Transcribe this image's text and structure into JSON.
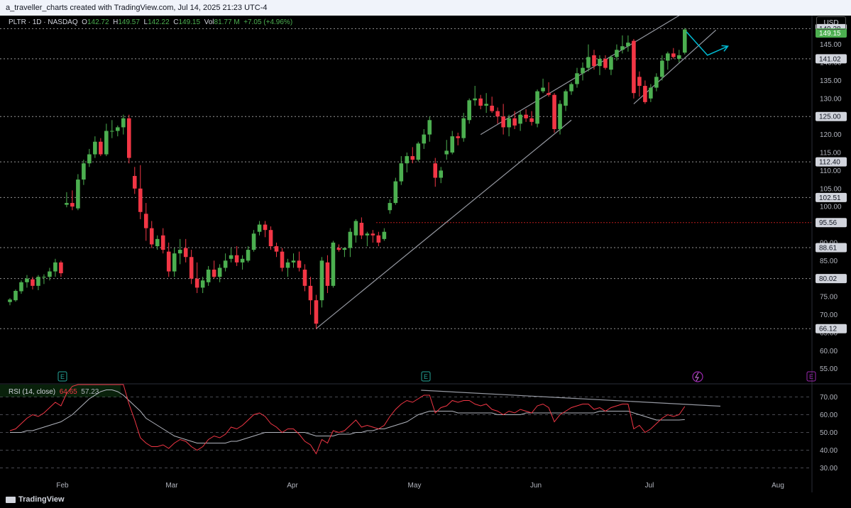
{
  "header": {
    "text": "a_traveller_charts created with TradingView.com, Jul 14, 2025 21:23 UTC-4"
  },
  "legend": {
    "symbol": "PLTR · 1D · NASDAQ",
    "o_label": "O",
    "o": "142.72",
    "h_label": "H",
    "h": "149.57",
    "l_label": "L",
    "l": "142.22",
    "c_label": "C",
    "c": "149.15",
    "vol_label": "Vol",
    "vol": "81.77 M",
    "change": "+7.05 (+4.96%)"
  },
  "currency": "USD",
  "rsi_legend": {
    "label": "RSI (14, close)",
    "rsi": "64.65",
    "ma": "57.23"
  },
  "footer": {
    "brand": "TradingView"
  },
  "colors": {
    "up": "#4caf50",
    "down": "#f23645",
    "rsi": "#f23645",
    "rsi_ma": "#b2b5be",
    "trendline": "#9598a1",
    "arrow": "#00bcd4",
    "support": "#b71c1c"
  },
  "chart_data": {
    "type": "candlestick",
    "ticker": "PLTR",
    "interval": "1D",
    "exchange": "NASDAQ",
    "x_labels": [
      "Feb",
      "Mar",
      "Apr",
      "May",
      "Jun",
      "Jul",
      "Aug"
    ],
    "price_axis": {
      "ylim": [
        51,
        153
      ],
      "ticks": [
        55,
        60,
        65,
        70,
        75,
        80,
        85,
        90,
        95,
        100,
        105,
        110,
        115,
        120,
        125,
        130,
        135,
        140,
        145
      ],
      "tick_labels": [
        "55.00",
        "60.00",
        "65.00",
        "70.00",
        "75.00",
        "80.00",
        "85.00",
        "90.00",
        "95.00",
        "100.00",
        "105.00",
        "110.00",
        "115.00",
        "120.00",
        "125.00",
        "130.00",
        "135.00",
        "140.00",
        "145.00"
      ]
    },
    "price_levels": [
      {
        "value": 149.38,
        "label": "149.38",
        "style": "dotted",
        "tag": "grey"
      },
      {
        "value": 149.15,
        "label": "149.15",
        "style": "none",
        "tag": "green"
      },
      {
        "value": 141.02,
        "label": "141.02",
        "style": "dotted",
        "tag": "grey"
      },
      {
        "value": 125.0,
        "label": "125.00",
        "style": "dotted",
        "tag": "grey"
      },
      {
        "value": 112.4,
        "label": "112.40",
        "style": "dotted",
        "tag": "grey"
      },
      {
        "value": 102.51,
        "label": "102.51",
        "style": "dotted",
        "tag": "grey"
      },
      {
        "value": 95.56,
        "label": "95.56",
        "style": "red-dotted",
        "tag": "grey"
      },
      {
        "value": 88.61,
        "label": "88.61",
        "style": "dotted",
        "tag": "grey"
      },
      {
        "value": 80.02,
        "label": "80.02",
        "style": "dotted",
        "tag": "grey"
      },
      {
        "value": 66.12,
        "label": "66.12",
        "style": "dotted",
        "tag": "grey"
      }
    ],
    "candles": [
      [
        73.5,
        74.6,
        72.6,
        74.2
      ],
      [
        74.0,
        77.0,
        73.6,
        76.6
      ],
      [
        76.5,
        79.5,
        75.8,
        79.0
      ],
      [
        79.0,
        81.0,
        77.5,
        80.0
      ],
      [
        79.8,
        80.5,
        77.0,
        78.0
      ],
      [
        78.0,
        81.0,
        76.8,
        80.5
      ],
      [
        80.5,
        81.2,
        78.5,
        80.5
      ],
      [
        80.5,
        83.0,
        79.5,
        82.0
      ],
      [
        82.0,
        85.5,
        80.5,
        84.5
      ],
      [
        84.5,
        85.0,
        80.5,
        81.5
      ],
      [
        100.5,
        104.0,
        99.8,
        101.0
      ],
      [
        101.0,
        104.5,
        99.0,
        100.0
      ],
      [
        99.5,
        109.0,
        99.0,
        107.5
      ],
      [
        107.5,
        113.0,
        106.0,
        112.0
      ],
      [
        112.0,
        116.0,
        111.0,
        114.5
      ],
      [
        114.5,
        119.5,
        113.5,
        118.0
      ],
      [
        118.0,
        119.0,
        114.0,
        114.5
      ],
      [
        114.5,
        123.0,
        114.0,
        121.0
      ],
      [
        121.0,
        124.0,
        119.0,
        121.0
      ],
      [
        121.0,
        122.5,
        119.5,
        122.0
      ],
      [
        122.0,
        125.5,
        120.0,
        124.5
      ],
      [
        124.5,
        125.5,
        112.0,
        113.5
      ],
      [
        108.5,
        111.0,
        103.5,
        105.0
      ],
      [
        105.0,
        111.5,
        96.5,
        98.5
      ],
      [
        98.0,
        101.0,
        90.5,
        94.0
      ],
      [
        94.0,
        96.0,
        88.5,
        89.5
      ],
      [
        89.0,
        92.0,
        88.0,
        91.0
      ],
      [
        92.0,
        94.0,
        87.0,
        88.0
      ],
      [
        87.5,
        90.0,
        80.5,
        82.0
      ],
      [
        82.0,
        88.5,
        80.5,
        87.0
      ],
      [
        87.0,
        91.0,
        84.0,
        88.0
      ],
      [
        88.5,
        91.0,
        84.5,
        86.0
      ],
      [
        86.0,
        88.0,
        78.5,
        80.0
      ],
      [
        80.0,
        84.5,
        76.0,
        77.5
      ],
      [
        77.5,
        80.5,
        76.0,
        79.5
      ],
      [
        79.0,
        83.5,
        78.0,
        82.5
      ],
      [
        82.5,
        85.0,
        80.0,
        80.5
      ],
      [
        80.5,
        84.0,
        79.0,
        83.0
      ],
      [
        83.0,
        87.0,
        82.0,
        85.0
      ],
      [
        85.5,
        88.5,
        84.5,
        86.5
      ],
      [
        86.5,
        89.0,
        83.5,
        84.5
      ],
      [
        84.5,
        86.5,
        82.5,
        85.5
      ],
      [
        85.0,
        89.0,
        84.5,
        88.0
      ],
      [
        88.0,
        93.5,
        87.5,
        92.5
      ],
      [
        93.0,
        96.0,
        92.0,
        95.0
      ],
      [
        95.0,
        96.0,
        91.5,
        93.5
      ],
      [
        93.5,
        94.5,
        88.0,
        89.0
      ],
      [
        89.0,
        90.0,
        86.0,
        87.5
      ],
      [
        87.5,
        88.5,
        82.0,
        83.0
      ],
      [
        83.0,
        85.5,
        80.5,
        84.5
      ],
      [
        84.5,
        87.0,
        83.0,
        85.0
      ],
      [
        85.0,
        87.5,
        82.0,
        83.0
      ],
      [
        82.5,
        84.0,
        76.5,
        78.0
      ],
      [
        78.0,
        80.5,
        70.0,
        74.0
      ],
      [
        74.0,
        75.5,
        66.1,
        67.5
      ],
      [
        74.0,
        86.0,
        72.0,
        85.0
      ],
      [
        84.5,
        86.5,
        76.0,
        78.0
      ],
      [
        78.0,
        90.5,
        77.5,
        90.0
      ],
      [
        88.5,
        89.5,
        87.5,
        88.0
      ],
      [
        88.0,
        88.5,
        86.0,
        88.5
      ],
      [
        88.5,
        94.0,
        86.0,
        93.0
      ],
      [
        92.0,
        96.5,
        90.0,
        96.0
      ],
      [
        95.5,
        97.0,
        91.0,
        92.0
      ],
      [
        92.0,
        93.0,
        89.0,
        92.5
      ],
      [
        92.5,
        93.5,
        90.0,
        92.0
      ],
      [
        92.0,
        93.0,
        89.0,
        90.0
      ],
      [
        91.0,
        94.0,
        90.5,
        93.0
      ],
      [
        99.0,
        102.0,
        98.0,
        101.0
      ],
      [
        101.0,
        108.0,
        100.5,
        107.0
      ],
      [
        107.0,
        114.0,
        106.0,
        112.0
      ],
      [
        112.0,
        115.0,
        109.5,
        114.0
      ],
      [
        114.0,
        116.5,
        112.0,
        113.0
      ],
      [
        113.0,
        118.0,
        112.5,
        117.5
      ],
      [
        117.5,
        121.5,
        116.0,
        120.0
      ],
      [
        120.0,
        125.0,
        118.0,
        124.0
      ],
      [
        112.0,
        113.5,
        105.5,
        108.0
      ],
      [
        108.0,
        111.0,
        106.5,
        110.0
      ],
      [
        114.5,
        118.5,
        113.0,
        115.5
      ],
      [
        115.0,
        121.0,
        114.5,
        119.5
      ],
      [
        119.5,
        120.5,
        117.0,
        119.0
      ],
      [
        119.0,
        126.0,
        118.0,
        124.5
      ],
      [
        124.0,
        130.0,
        123.0,
        129.5
      ],
      [
        129.5,
        133.5,
        128.0,
        130.0
      ],
      [
        130.0,
        131.0,
        127.0,
        128.0
      ],
      [
        128.0,
        131.5,
        126.0,
        128.5
      ],
      [
        128.0,
        130.5,
        126.0,
        126.5
      ],
      [
        126.5,
        127.5,
        123.0,
        125.0
      ],
      [
        125.0,
        128.5,
        120.0,
        122.0
      ],
      [
        122.0,
        125.5,
        119.5,
        124.5
      ],
      [
        124.5,
        126.5,
        121.5,
        122.5
      ],
      [
        123.0,
        126.5,
        121.0,
        125.5
      ],
      [
        125.5,
        127.0,
        123.5,
        124.5
      ],
      [
        124.5,
        126.5,
        122.5,
        123.5
      ],
      [
        123.0,
        132.5,
        122.0,
        132.0
      ],
      [
        132.0,
        135.5,
        131.5,
        133.0
      ],
      [
        131.5,
        134.5,
        130.5,
        131.0
      ],
      [
        131.0,
        131.5,
        120.5,
        121.5
      ],
      [
        121.5,
        129.5,
        120.0,
        128.5
      ],
      [
        128.0,
        132.5,
        126.5,
        132.0
      ],
      [
        132.0,
        134.5,
        131.0,
        134.0
      ],
      [
        134.0,
        138.5,
        133.0,
        137.0
      ],
      [
        137.0,
        140.0,
        135.0,
        138.5
      ],
      [
        138.5,
        145.0,
        137.5,
        141.5
      ],
      [
        142.0,
        143.5,
        138.0,
        139.0
      ],
      [
        139.0,
        142.0,
        136.5,
        141.0
      ],
      [
        141.0,
        142.0,
        138.0,
        138.5
      ],
      [
        138.0,
        142.0,
        136.5,
        141.5
      ],
      [
        141.5,
        145.0,
        140.5,
        143.5
      ],
      [
        143.5,
        147.5,
        142.5,
        144.5
      ],
      [
        144.5,
        147.5,
        143.0,
        145.5
      ],
      [
        146.0,
        146.5,
        130.0,
        131.5
      ],
      [
        136.0,
        137.5,
        130.5,
        133.5
      ],
      [
        133.5,
        135.0,
        128.5,
        129.0
      ],
      [
        130.0,
        134.0,
        129.0,
        133.0
      ],
      [
        133.0,
        137.0,
        132.0,
        136.0
      ],
      [
        136.0,
        142.0,
        135.0,
        140.5
      ],
      [
        140.5,
        143.0,
        138.0,
        142.5
      ],
      [
        142.5,
        144.0,
        141.0,
        141.5
      ],
      [
        141.0,
        143.5,
        140.0,
        142.0
      ],
      [
        142.72,
        149.57,
        142.22,
        149.15
      ]
    ],
    "rsi": {
      "label": "RSI (14, close)",
      "ylim": [
        25,
        77
      ],
      "ticks": [
        30,
        40,
        50,
        60,
        70
      ],
      "tick_labels": [
        "30.00",
        "40.00",
        "50.00",
        "60.00",
        "70.00"
      ],
      "rsi_last": 64.65,
      "ma_last": 57.23,
      "rsi_values": [
        51,
        52,
        55,
        58,
        60,
        59,
        61,
        64,
        67,
        65,
        72,
        76,
        78,
        80,
        82,
        82,
        79,
        81,
        82,
        79,
        80,
        66,
        57,
        47,
        44,
        42,
        42,
        43,
        41,
        44,
        46,
        45,
        42,
        40,
        42,
        46,
        48,
        47,
        49,
        53,
        52,
        54,
        57,
        60,
        61,
        59,
        55,
        53,
        50,
        52,
        52,
        49,
        45,
        43,
        38,
        46,
        44,
        51,
        50,
        51,
        54,
        57,
        53,
        54,
        53,
        52,
        54,
        59,
        63,
        66,
        68,
        67,
        69,
        71,
        71,
        61,
        64,
        65,
        68,
        67,
        68,
        68,
        66,
        65,
        66,
        63,
        62,
        60,
        62,
        61,
        63,
        62,
        61,
        65,
        66,
        64,
        56,
        60,
        62,
        64,
        65,
        66,
        66,
        63,
        64,
        62,
        64,
        65,
        66,
        66,
        52,
        54,
        50,
        52,
        55,
        58,
        60,
        59,
        60,
        64.65
      ],
      "ma_values": [
        50,
        50,
        50,
        51,
        51,
        52,
        53,
        54,
        55,
        56,
        58,
        60,
        63,
        66,
        69,
        71,
        73,
        74,
        74,
        73,
        71,
        68,
        65,
        62,
        58,
        56,
        54,
        52,
        50,
        48,
        47,
        46,
        45,
        44,
        44,
        44,
        44,
        44,
        44,
        45,
        45,
        46,
        47,
        48,
        49,
        50,
        50,
        50,
        50,
        50,
        50,
        50,
        50,
        49,
        48,
        48,
        48,
        48,
        49,
        49,
        49,
        50,
        50,
        51,
        51,
        52,
        52,
        53,
        54,
        55,
        56,
        58,
        60,
        61,
        62,
        62,
        62,
        62,
        62,
        61,
        61,
        61,
        61,
        61,
        61,
        61,
        60,
        60,
        60,
        60,
        60,
        61,
        61,
        61,
        61,
        61,
        61,
        61,
        61,
        61,
        61,
        61,
        61,
        61,
        62,
        62,
        62,
        62,
        62,
        62,
        61,
        60,
        59,
        58,
        57,
        57,
        57,
        57,
        57,
        57.23
      ]
    },
    "rsi_trendline": {
      "from": [
        0.835,
        73.8
      ],
      "to": [
        1.25,
        64.8
      ]
    },
    "trendlines": [
      {
        "from": [
          54,
          66.12
        ],
        "to": [
          99,
          124.0
        ]
      },
      {
        "from": [
          83,
          120.0
        ],
        "to": [
          118.5,
          153.5
        ]
      },
      {
        "from": [
          110,
          128.5
        ],
        "to": [
          124.5,
          149.0
        ]
      }
    ],
    "forecast_arrow": [
      [
        119.3,
        148.5
      ],
      [
        123,
        142.0
      ],
      [
        126.6,
        144.5
      ]
    ],
    "earnings_markers": [
      "E",
      "E"
    ],
    "event_markers": [
      "dividend",
      "E"
    ]
  }
}
